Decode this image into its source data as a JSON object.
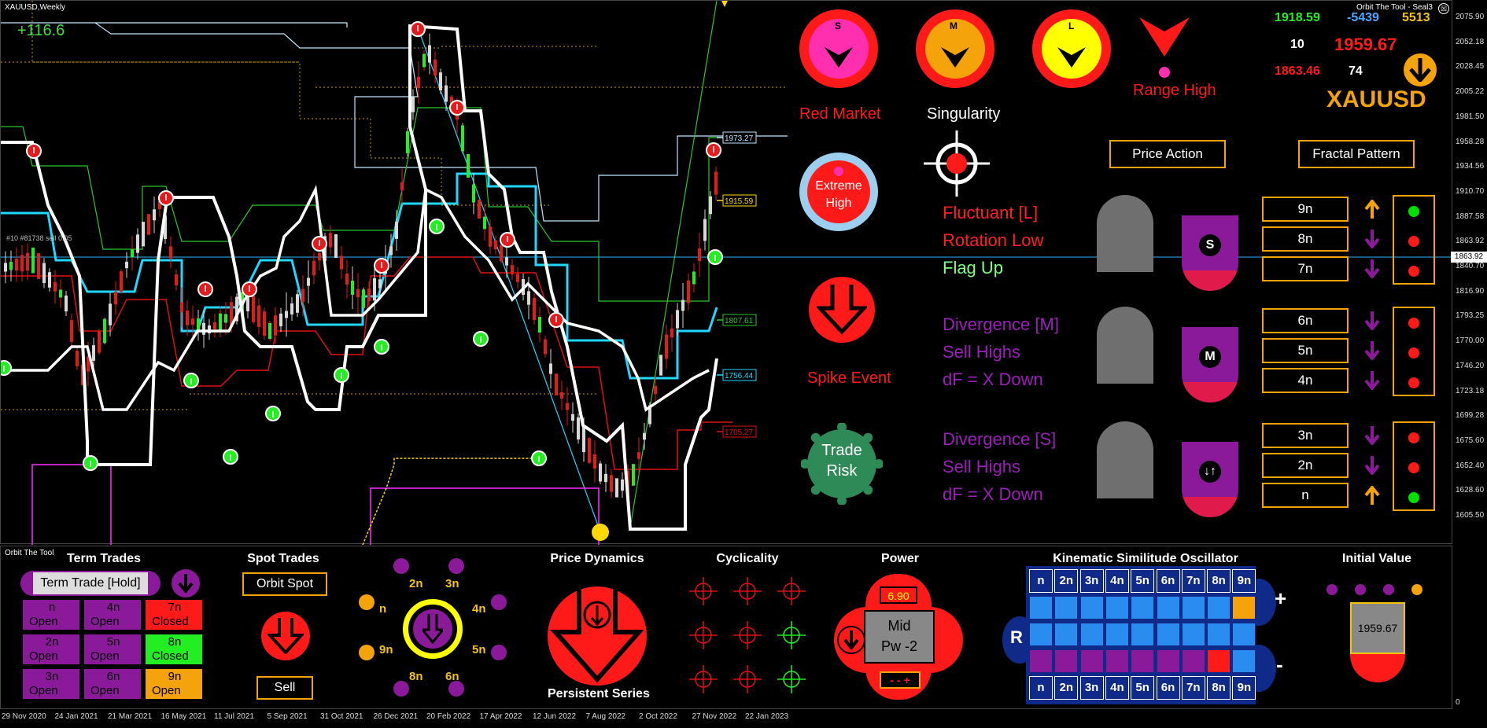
{
  "window": {
    "title": "XAUUSD,Weekly",
    "indicator_name": "Orbit The Tool - Seal3"
  },
  "chart": {
    "profit_label": "+116.6",
    "order_label": "#10 #81738 sell 0.05",
    "level_tags": [
      "1973.27",
      "1915.59",
      "1807.61",
      "1756.44",
      "1705.27"
    ],
    "price_axis": [
      "2075.90",
      "2052.18",
      "2028.45",
      "2005.22",
      "1981.50",
      "1958.28",
      "1934.56",
      "1910.70",
      "1887.58",
      "1863.92",
      "1840.70",
      "1816.90",
      "1793.25",
      "1770.00",
      "1746.20",
      "1723.18",
      "1699.28",
      "1675.60",
      "1652.40",
      "1628.60",
      "1605.50"
    ],
    "current_price_tag": "1863.92",
    "dates": [
      "29 Nov 2020",
      "24 Jan 2021",
      "21 Mar 2021",
      "16 May 2021",
      "11 Jul 2021",
      "5 Sep 2021",
      "31 Oct 2021",
      "26 Dec 2021",
      "20 Feb 2022",
      "17 Apr 2022",
      "12 Jun 2022",
      "7 Aug 2022",
      "2 Oct 2022",
      "27 Nov 2022",
      "22 Jan 2023"
    ]
  },
  "dashboard": {
    "lamps": [
      {
        "letter": "S",
        "color": "#ff2fb0"
      },
      {
        "letter": "M",
        "color": "#f5a30a"
      },
      {
        "letter": "L",
        "color": "#ffff00"
      }
    ],
    "range_high": "Range High",
    "red_market": "Red Market",
    "singularity": "Singularity",
    "extreme_high": [
      "Extreme",
      "High"
    ],
    "spike_event": "Spike Event",
    "trade_risk": [
      "Trade",
      "Risk"
    ],
    "stats": {
      "a": "1918.59",
      "b": "-5439",
      "c": "5513",
      "d": "10",
      "e": "1959.67",
      "f": "1863.46",
      "g": "74"
    },
    "symbol": "XAUUSD",
    "price_action_button": "Price Action",
    "fractal_pattern_button": "Fractal Pattern",
    "groups": [
      {
        "lines": [
          "Fluctuant [L]",
          "Rotation Low",
          "Flag Up"
        ],
        "colors": [
          "#ff2020",
          "#ff2020",
          "#7fff7f"
        ],
        "badge": "S",
        "nums": [
          "9n",
          "8n",
          "7n"
        ],
        "arrows": [
          "up",
          "down",
          "down"
        ],
        "dots": [
          "#00e000",
          "#ff1a1a",
          "#ff1a1a"
        ]
      },
      {
        "lines": [
          "Divergence [M]",
          "Sell Highs",
          "dF = X Down"
        ],
        "colors": [
          "#9b1fb8",
          "#9b1fb8",
          "#9b1fb8"
        ],
        "badge": "M",
        "nums": [
          "6n",
          "5n",
          "4n"
        ],
        "arrows": [
          "down",
          "down",
          "down"
        ],
        "dots": [
          "#ff1a1a",
          "#ff1a1a",
          "#ff1a1a"
        ]
      },
      {
        "lines": [
          "Divergence [S]",
          "Sell Highs",
          "dF = X Down"
        ],
        "colors": [
          "#9b1fb8",
          "#9b1fb8",
          "#9b1fb8"
        ],
        "badge": "↓↑",
        "nums": [
          "3n",
          "2n",
          "n"
        ],
        "arrows": [
          "down",
          "down",
          "up"
        ],
        "dots": [
          "#ff1a1a",
          "#ff1a1a",
          "#00e000"
        ]
      }
    ]
  },
  "bottom": {
    "panel_name": "Orbit The Tool",
    "term_trades": {
      "title": "Term Trades",
      "button": "Term Trade [Hold]",
      "cells": [
        {
          "l1": "n",
          "l2": "Open",
          "bg": "#8b1a9a"
        },
        {
          "l1": "4n",
          "l2": "Open",
          "bg": "#8b1a9a"
        },
        {
          "l1": "7n",
          "l2": "Closed",
          "bg": "#ff1a1a"
        },
        {
          "l1": "2n",
          "l2": "Open",
          "bg": "#8b1a9a"
        },
        {
          "l1": "5n",
          "l2": "Open",
          "bg": "#8b1a9a"
        },
        {
          "l1": "8n",
          "l2": "Closed",
          "bg": "#22ee22"
        },
        {
          "l1": "3n",
          "l2": "Open",
          "bg": "#8b1a9a"
        },
        {
          "l1": "6n",
          "l2": "Open",
          "bg": "#8b1a9a"
        },
        {
          "l1": "9n",
          "l2": "Open",
          "bg": "#f5a30a"
        }
      ]
    },
    "spot_trades": {
      "title": "Spot Trades",
      "button": "Orbit Spot",
      "action": "Sell"
    },
    "orbit_labels": [
      "2n",
      "3n",
      "4n",
      "5n",
      "6n",
      "8n",
      "9n",
      "n"
    ],
    "price_dynamics": {
      "title": "Price Dynamics",
      "subtitle": "Persistent Series"
    },
    "cyclicality": {
      "title": "Cyclicality"
    },
    "power": {
      "title": "Power",
      "value": "6.90",
      "state": "Mid",
      "pw": "Pw -2",
      "signs": "- - +"
    },
    "kso": {
      "title": "Kinematic Similitude Oscillator",
      "headers": [
        "n",
        "2n",
        "3n",
        "4n",
        "5n",
        "6n",
        "7n",
        "8n",
        "9n"
      ],
      "r": "R",
      "plus": "+",
      "minus": "-"
    },
    "initial_value": {
      "title": "Initial Value",
      "value": "1959.67"
    },
    "sub_axis_zero": "0"
  }
}
